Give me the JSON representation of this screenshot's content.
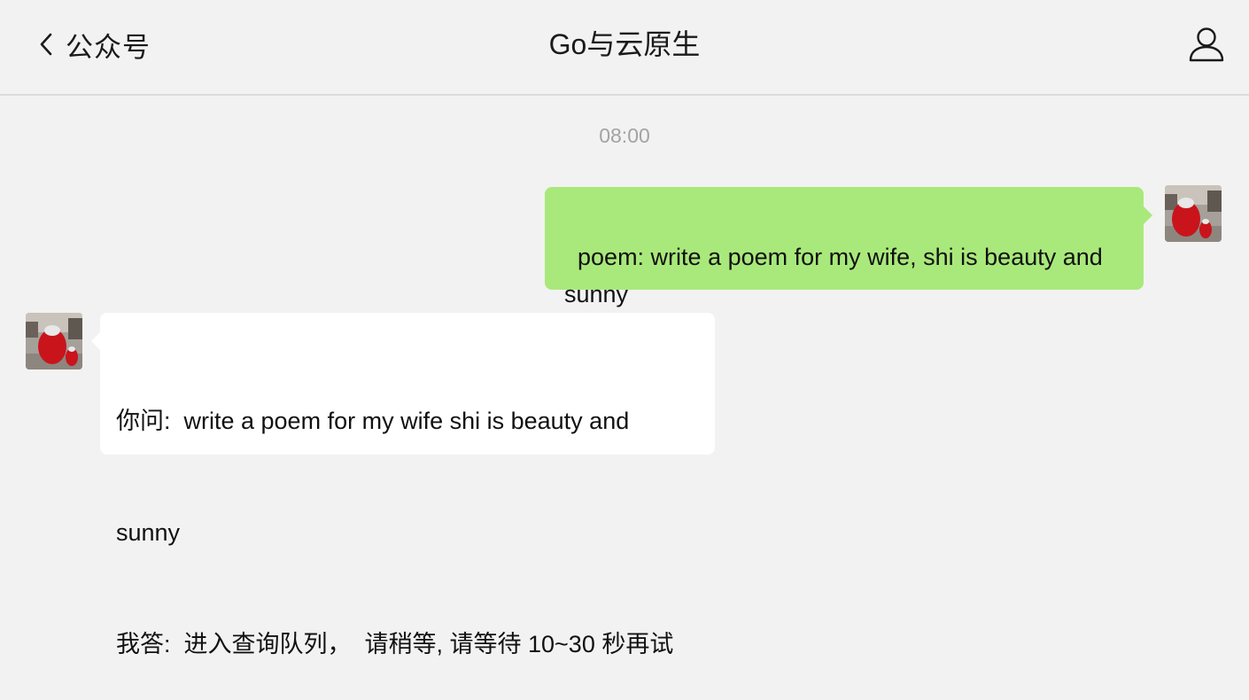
{
  "header": {
    "back_label": "公众号",
    "title": "Go与云原生"
  },
  "chat": {
    "timestamp": "08:00",
    "messages": [
      {
        "direction": "outgoing",
        "text": "poem: write a poem for my wife, shi is beauty and sunny",
        "bubble_color": "#a9e97b"
      },
      {
        "direction": "incoming",
        "line1": "你问:  write a poem for my wife shi is beauty and",
        "line2": "sunny",
        "line3": "我答:  进入查询队列，  请稍等, 请等待 10~30 秒再试",
        "bubble_color": "#ffffff"
      }
    ]
  },
  "icons": {
    "back": "chevron-left-icon",
    "profile": "person-outline-icon",
    "avatar": "red-figures-photo"
  },
  "colors": {
    "background": "#f2f2f2",
    "outgoing_bubble": "#a9e97b",
    "incoming_bubble": "#ffffff",
    "timestamp": "#a3a3a3"
  }
}
